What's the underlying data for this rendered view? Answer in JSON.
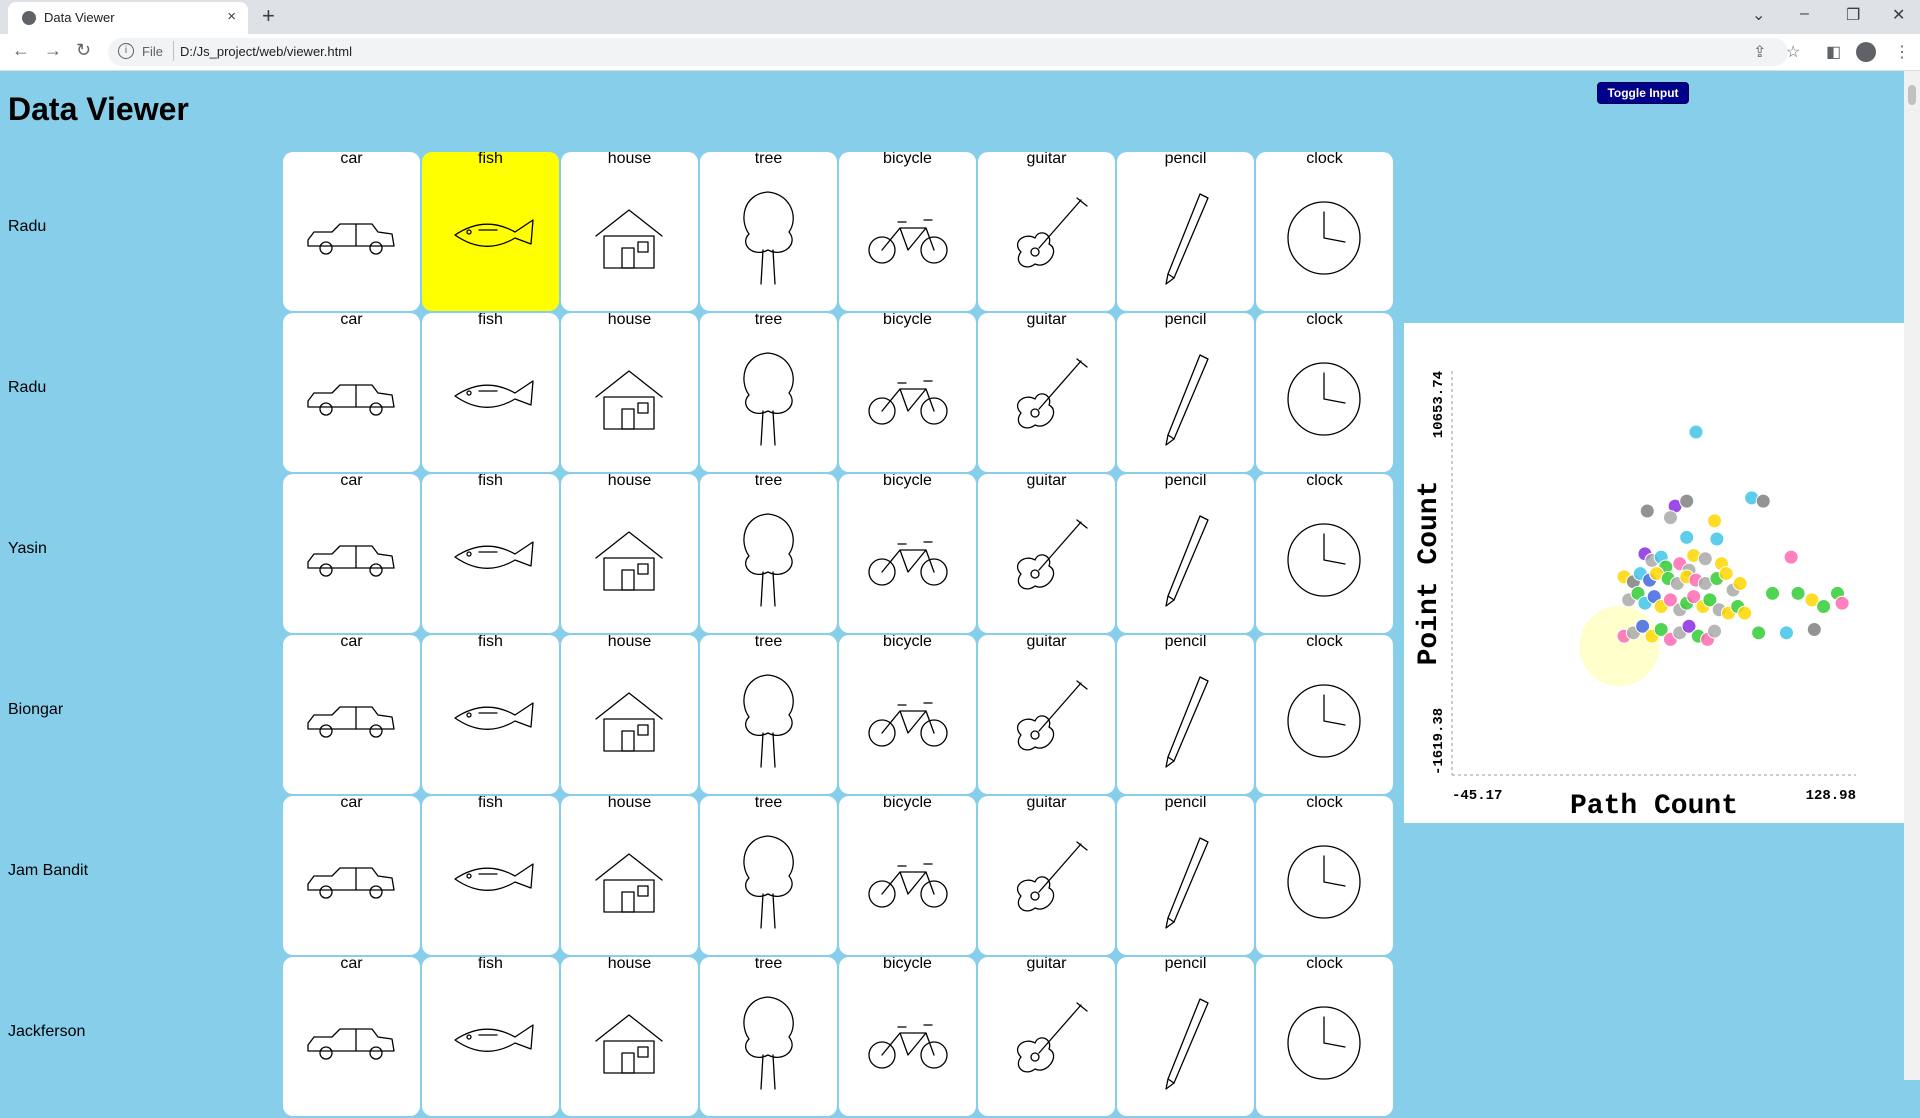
{
  "browser": {
    "tab_title": "Data Viewer",
    "tab_close": "×",
    "new_tab": "+",
    "scheme": "File",
    "url": "D:/Js_project/web/viewer.html",
    "info_glyph": "i"
  },
  "page": {
    "title": "Data Viewer",
    "toggle_label": "Toggle Input"
  },
  "rows": [
    {
      "name": "Radu"
    },
    {
      "name": "Radu"
    },
    {
      "name": "Yasin"
    },
    {
      "name": "Biongar"
    },
    {
      "name": "Jam Bandit"
    },
    {
      "name": "Jackferson"
    }
  ],
  "categories": [
    "car",
    "fish",
    "house",
    "tree",
    "bicycle",
    "guitar",
    "pencil",
    "clock"
  ],
  "highlight": {
    "row": 0,
    "category": "fish",
    "color": "#ffff00"
  },
  "chart_data": {
    "type": "scatter",
    "xlabel": "Path Count",
    "ylabel": "Point Count",
    "xlim": [
      -45.17,
      128.98
    ],
    "ylim": [
      -1619.38,
      10653.74
    ],
    "x_tick_labels": [
      "-45.17",
      "128.98"
    ],
    "y_tick_labels": [
      "-1619.38",
      "10653.74"
    ],
    "category_colors": {
      "car": "#808080",
      "fish": "#4169e1",
      "house": "#ffd700",
      "tree": "#32cd32",
      "bicycle": "#40c4e6",
      "guitar": "#8a2be2",
      "pencil": "#ff69b4",
      "clock": "#a9a9a9"
    },
    "points": [
      {
        "c": "bicycle",
        "x": 60,
        "y": 8800
      },
      {
        "c": "bicycle",
        "x": 84,
        "y": 6800
      },
      {
        "c": "car",
        "x": 89,
        "y": 6700
      },
      {
        "c": "car",
        "x": 39,
        "y": 6400
      },
      {
        "c": "guitar",
        "x": 51,
        "y": 6550
      },
      {
        "c": "car",
        "x": 56,
        "y": 6700
      },
      {
        "c": "clock",
        "x": 49,
        "y": 6200
      },
      {
        "c": "house",
        "x": 68,
        "y": 6100
      },
      {
        "c": "bicycle",
        "x": 56,
        "y": 5600
      },
      {
        "c": "bicycle",
        "x": 69,
        "y": 5550
      },
      {
        "c": "pencil",
        "x": 101,
        "y": 5000
      },
      {
        "c": "guitar",
        "x": 38,
        "y": 5100
      },
      {
        "c": "clock",
        "x": 41,
        "y": 4900
      },
      {
        "c": "bicycle",
        "x": 45,
        "y": 5000
      },
      {
        "c": "house",
        "x": 59,
        "y": 5050
      },
      {
        "c": "clock",
        "x": 64,
        "y": 4950
      },
      {
        "c": "house",
        "x": 71,
        "y": 4800
      },
      {
        "c": "pencil",
        "x": 53,
        "y": 4800
      },
      {
        "c": "tree",
        "x": 47,
        "y": 4700
      },
      {
        "c": "clock",
        "x": 57,
        "y": 4600
      },
      {
        "c": "house",
        "x": 29,
        "y": 4400
      },
      {
        "c": "car",
        "x": 33,
        "y": 4250
      },
      {
        "c": "bicycle",
        "x": 36,
        "y": 4500
      },
      {
        "c": "fish",
        "x": 40,
        "y": 4300
      },
      {
        "c": "house",
        "x": 43,
        "y": 4500
      },
      {
        "c": "tree",
        "x": 48,
        "y": 4350
      },
      {
        "c": "clock",
        "x": 52,
        "y": 4200
      },
      {
        "c": "house",
        "x": 56,
        "y": 4400
      },
      {
        "c": "pencil",
        "x": 60,
        "y": 4300
      },
      {
        "c": "clock",
        "x": 64,
        "y": 4200
      },
      {
        "c": "tree",
        "x": 69,
        "y": 4350
      },
      {
        "c": "house",
        "x": 73,
        "y": 4500
      },
      {
        "c": "clock",
        "x": 76,
        "y": 4000
      },
      {
        "c": "house",
        "x": 79,
        "y": 4200
      },
      {
        "c": "tree",
        "x": 93,
        "y": 3900
      },
      {
        "c": "tree",
        "x": 104,
        "y": 3900
      },
      {
        "c": "house",
        "x": 110,
        "y": 3700
      },
      {
        "c": "tree",
        "x": 115,
        "y": 3500
      },
      {
        "c": "tree",
        "x": 121,
        "y": 3900
      },
      {
        "c": "pencil",
        "x": 123,
        "y": 3600
      },
      {
        "c": "clock",
        "x": 31,
        "y": 3700
      },
      {
        "c": "tree",
        "x": 35,
        "y": 3900
      },
      {
        "c": "bicycle",
        "x": 38,
        "y": 3600
      },
      {
        "c": "fish",
        "x": 42,
        "y": 3800
      },
      {
        "c": "house",
        "x": 45,
        "y": 3500
      },
      {
        "c": "pencil",
        "x": 49,
        "y": 3700
      },
      {
        "c": "clock",
        "x": 53,
        "y": 3400
      },
      {
        "c": "tree",
        "x": 56,
        "y": 3600
      },
      {
        "c": "pencil",
        "x": 59,
        "y": 3800
      },
      {
        "c": "house",
        "x": 63,
        "y": 3500
      },
      {
        "c": "tree",
        "x": 66,
        "y": 3700
      },
      {
        "c": "clock",
        "x": 70,
        "y": 3400
      },
      {
        "c": "house",
        "x": 74,
        "y": 3300
      },
      {
        "c": "tree",
        "x": 78,
        "y": 3500
      },
      {
        "c": "house",
        "x": 81,
        "y": 3300
      },
      {
        "c": "tree",
        "x": 87,
        "y": 2700
      },
      {
        "c": "bicycle",
        "x": 99,
        "y": 2700
      },
      {
        "c": "car",
        "x": 111,
        "y": 2800
      },
      {
        "c": "pencil",
        "x": 29,
        "y": 2600
      },
      {
        "c": "clock",
        "x": 33,
        "y": 2700
      },
      {
        "c": "fish",
        "x": 37,
        "y": 2900
      },
      {
        "c": "house",
        "x": 41,
        "y": 2600
      },
      {
        "c": "tree",
        "x": 45,
        "y": 2800
      },
      {
        "c": "pencil",
        "x": 49,
        "y": 2500
      },
      {
        "c": "clock",
        "x": 53,
        "y": 2700
      },
      {
        "c": "guitar",
        "x": 57,
        "y": 2900
      },
      {
        "c": "tree",
        "x": 61,
        "y": 2600
      },
      {
        "c": "pencil",
        "x": 65,
        "y": 2500
      },
      {
        "c": "clock",
        "x": 68,
        "y": 2750
      }
    ]
  }
}
